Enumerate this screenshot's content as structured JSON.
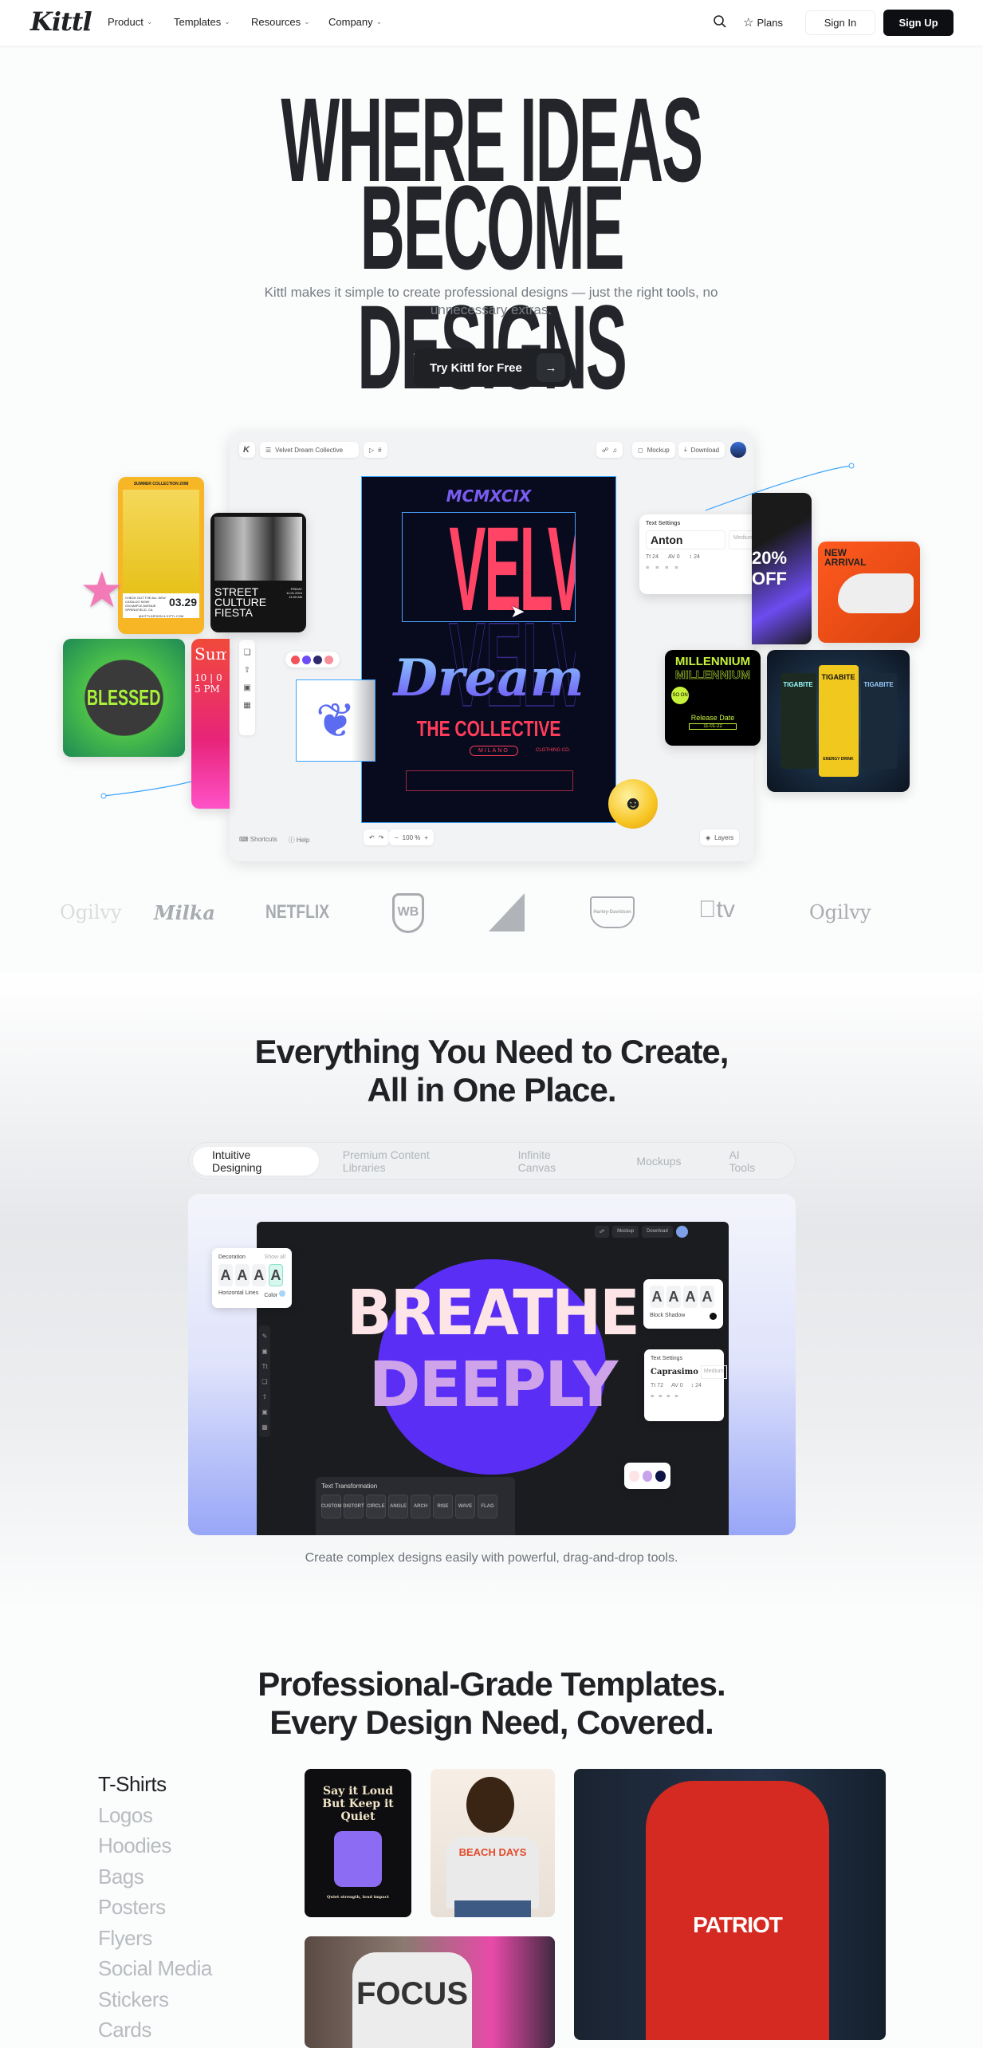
{
  "nav": {
    "logo": "Kittl",
    "items": [
      {
        "label": "Product"
      },
      {
        "label": "Templates"
      },
      {
        "label": "Resources"
      },
      {
        "label": "Company"
      }
    ],
    "plans": "Plans",
    "sign_in": "Sign In",
    "sign_up": "Sign Up"
  },
  "hero": {
    "line1": "WHERE IDEAS",
    "line2": "BECOME DESIGNS",
    "subtitle": "Kittl makes it simple to create professional designs — just the right tools, no unnecessary extras.",
    "cta": "Try Kittl for Free"
  },
  "editor": {
    "project_name": "Velvet Dream Collective",
    "mockup": "Mockup",
    "download": "Download",
    "shortcuts": "Shortcuts",
    "help": "Help",
    "zoom": "100 %",
    "layers": "Layers",
    "poster": {
      "top": "MCMXCIX",
      "title": "VELVET",
      "script": "Dream",
      "subtitle": "THE COLLECTIVE",
      "badge": "MILANO",
      "brand": "CLOTHING CO."
    },
    "text_settings": {
      "title": "Text Settings",
      "font": "Anton",
      "weight": "Medium",
      "size": "24",
      "tracking": "0",
      "line_height": "24"
    },
    "palette": [
      "#f0525a",
      "#6b4cf5",
      "#2e2a6b",
      "#f58f9b"
    ],
    "cards": {
      "catalog": {
        "header": "SUMMER COLLECTION 2098",
        "cta": "CHECK OUT THE ALL NEW CATALOG NOW!",
        "address": "234 MAPLE AVENUE SPRINGFIELD, CA",
        "date": "03.29",
        "handle": "@KITTLDESIGN & KITTL.COM"
      },
      "street": {
        "title": "STREET CULTURE FIESTA",
        "day": "FRIDAY",
        "date": "11.01.2024",
        "time": "11:00 AM"
      },
      "tshirt": {
        "text": "BLESSED"
      },
      "summer": {
        "title": "Summer Me",
        "date": "10 | 0",
        "time": "5 PM"
      },
      "sale": {
        "text": "20% OFF"
      },
      "sneaker": {
        "text": "NEW ARRIVAL"
      },
      "millennium": {
        "title": "MILLENNIUM",
        "badge": "SO ON",
        "label": "Release Date",
        "date": "11-01-22"
      },
      "cans": {
        "brand": "TIGABITE",
        "sub": "ENERGY DRINK"
      }
    }
  },
  "logos": [
    "Ogilvy",
    "Milka",
    "NETFLIX",
    "WB",
    "Paramount",
    "Harley-Davidson",
    "tv",
    "Ogilvy"
  ],
  "features": {
    "heading_line1": "Everything You Need to Create,",
    "heading_line2": "All in One Place.",
    "tabs": [
      {
        "label": "Intuitive Designing",
        "active": true
      },
      {
        "label": "Premium Content Libraries"
      },
      {
        "label": "Infinite Canvas"
      },
      {
        "label": "Mockups"
      },
      {
        "label": "AI Tools"
      }
    ],
    "demo": {
      "mockup": "Mockup",
      "download": "Download",
      "line1": "BREATHE",
      "line2": "DEEPLY",
      "decoration": {
        "title": "Decoration",
        "show_all": "Show all",
        "label": "Horizontal Lines",
        "color": "Color"
      },
      "shadow": {
        "label": "Block Shadow"
      },
      "text_settings": {
        "title": "Text Settings",
        "font": "Caprasimo",
        "weight": "Medium",
        "size": "72",
        "tracking": "0",
        "line_height": "24"
      },
      "palette": [
        "#fde4e6",
        "#c9a3ea",
        "#0f1446"
      ],
      "transform": {
        "title": "Text Transformation",
        "options": [
          "CUSTOM",
          "DISTORT",
          "CIRCLE",
          "ANGLE",
          "ARCH",
          "RISE",
          "WAVE",
          "FLAG"
        ]
      }
    },
    "caption": "Create complex designs easily with powerful, drag-and-drop tools."
  },
  "templates": {
    "heading_line1": "Professional-Grade Templates.",
    "heading_line2": "Every Design Need, Covered.",
    "categories": [
      {
        "label": "T-Shirts",
        "active": true
      },
      {
        "label": "Logos"
      },
      {
        "label": "Hoodies"
      },
      {
        "label": "Bags"
      },
      {
        "label": "Posters"
      },
      {
        "label": "Flyers"
      },
      {
        "label": "Social Media"
      },
      {
        "label": "Stickers"
      },
      {
        "label": "Cards"
      }
    ],
    "images": [
      {
        "text": "Say it Loud But Keep it Quiet",
        "sub": "Quiet strength, loud impact"
      },
      {
        "text": "BEACH DAYS"
      },
      {
        "text": "PATRIOT"
      },
      {
        "text": "FOCUS"
      }
    ]
  }
}
